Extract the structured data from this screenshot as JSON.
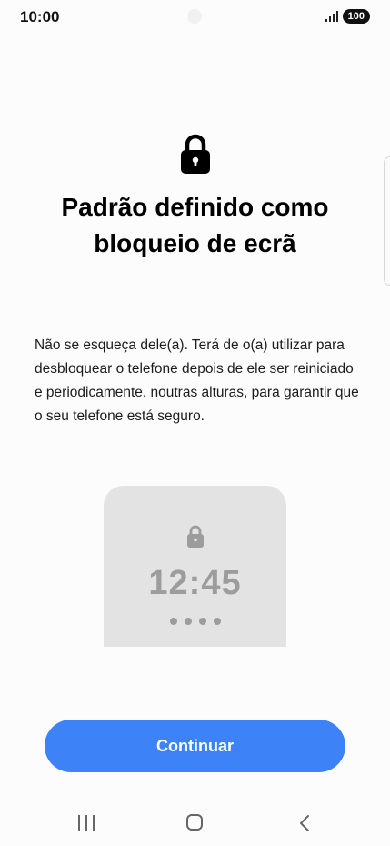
{
  "status_bar": {
    "time": "10:00",
    "battery": "100"
  },
  "content": {
    "title_line1": "Padrão definido como",
    "title_line2": "bloqueio de ecrã",
    "description": "Não se esqueça dele(a). Terá de o(a) utilizar para desbloquear o telefone depois de ele ser reiniciado e periodicamente, noutras alturas, para garantir que o seu telefone está seguro."
  },
  "preview": {
    "time": "12:45",
    "dots": 4
  },
  "actions": {
    "continue_label": "Continuar"
  },
  "colors": {
    "accent": "#3e82f7",
    "preview_bg": "#e3e3e3",
    "preview_fg": "#9c9c9c"
  }
}
